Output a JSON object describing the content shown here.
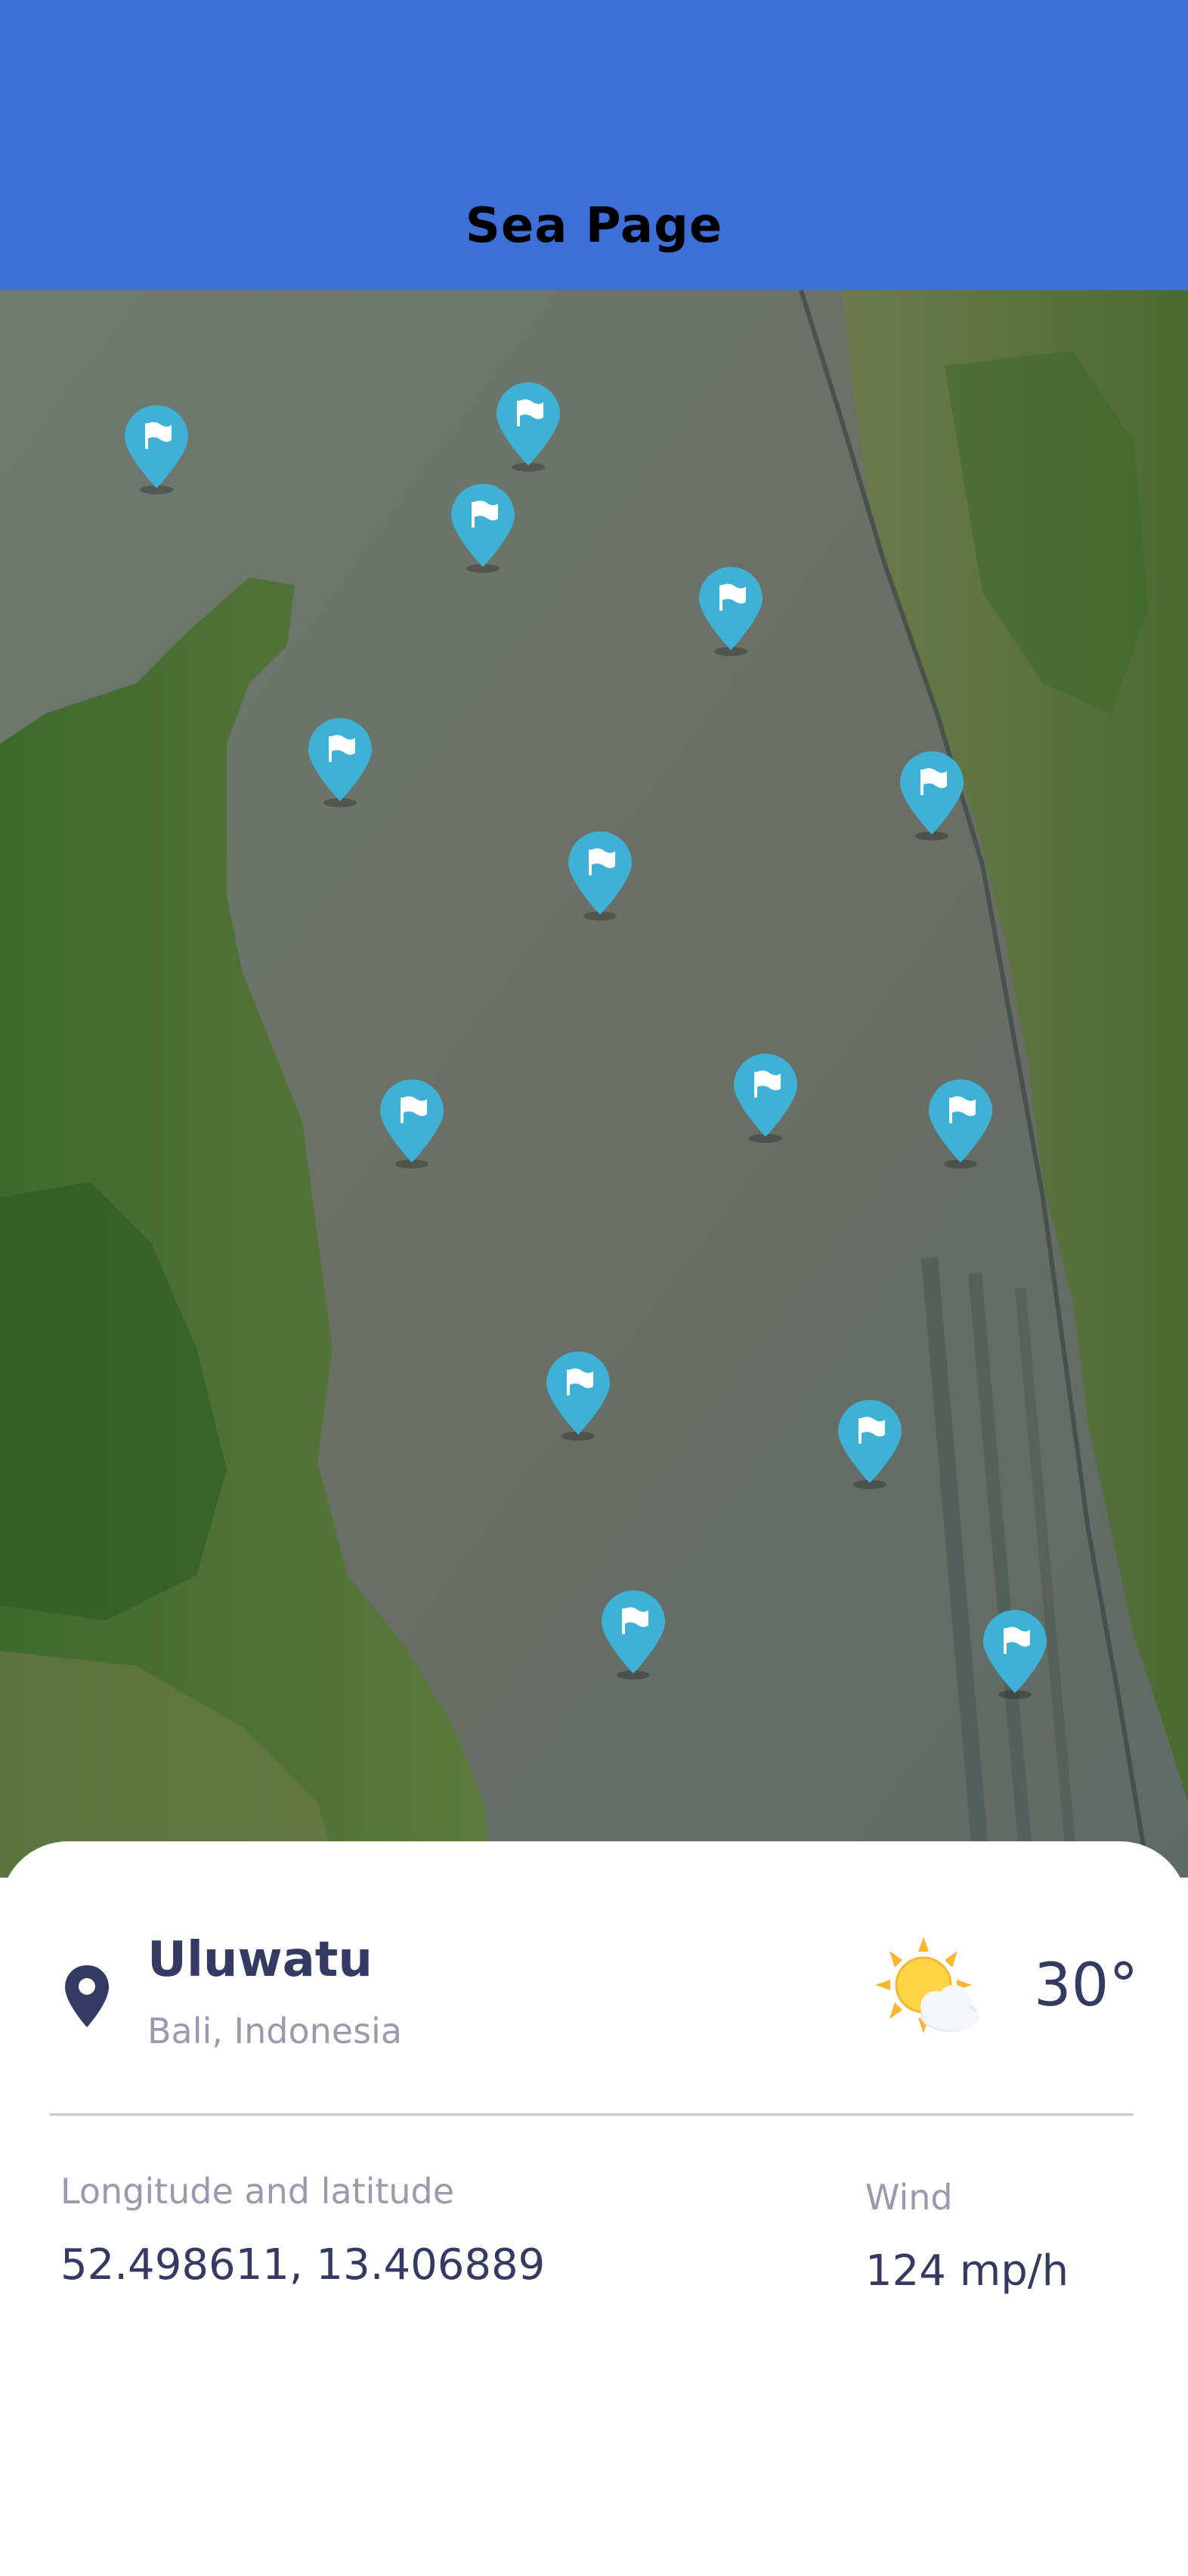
{
  "header": {
    "title": "Sea Page"
  },
  "map": {
    "icon": "flag-pin-icon",
    "pin_color": "#3fb1d4",
    "pin_count": 15
  },
  "location": {
    "name": "Uluwatu",
    "region": "Bali, Indonesia",
    "icon": "map-pin-icon"
  },
  "weather": {
    "icon": "sun-cloud-icon",
    "temperature": "30°"
  },
  "coordinates": {
    "label": "Longitude and latitude",
    "value": "52.498611, 13.406889"
  },
  "wind": {
    "label": "Wind",
    "value": "124 mp/h"
  },
  "colors": {
    "header_bg": "#3e6fd6",
    "text_primary": "#353a63",
    "text_secondary": "#9a9aae"
  }
}
